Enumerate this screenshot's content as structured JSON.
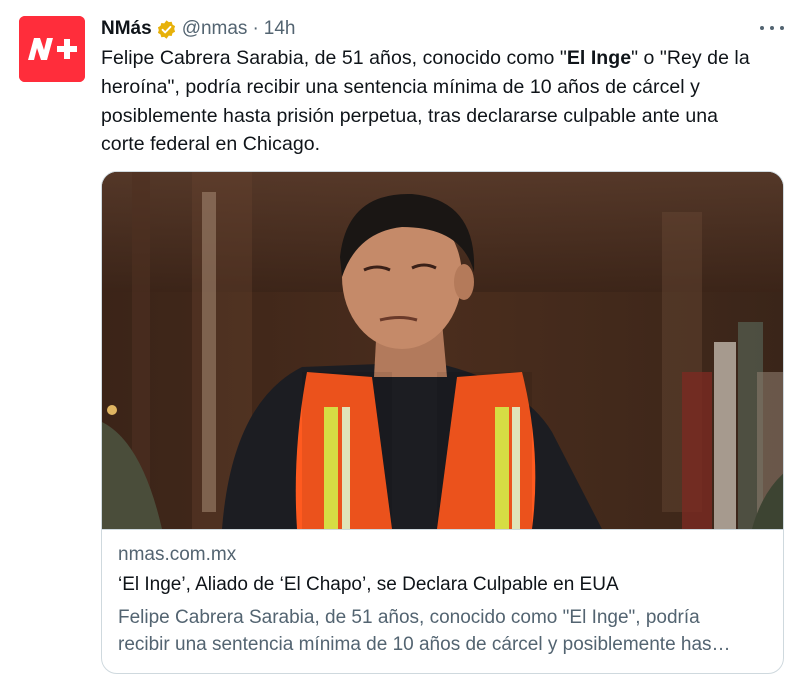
{
  "tweet": {
    "author": {
      "display_name": "NMás",
      "handle": "@nmas",
      "verified": true,
      "avatar_icon": "nmas-logo-icon"
    },
    "separator": "·",
    "timestamp": "14h",
    "text": {
      "line1_a": "Felipe Cabrera Sarabia, de 51 años, conocido como \"",
      "line1_bold": "El Inge",
      "line1_b": "\" o \"Rey de la",
      "line2": "heroína\", podría recibir una sentencia mínima de 10 años de cárcel y",
      "line3": "posiblemente hasta prisión perpetua, tras declararse culpable ante una",
      "line4": "corte federal en Chicago."
    },
    "card": {
      "domain": "nmas.com.mx",
      "title": "‘El Inge’, Aliado de ‘El Chapo’, se Declara Culpable en EUA",
      "description_line1": "Felipe Cabrera Sarabia, de 51 años, conocido como \"El Inge\", podría",
      "description_line2": "recibir una sentencia mínima de 10 años de cárcel y posiblemente has…"
    }
  },
  "colors": {
    "brand": "#ff2d3b",
    "verified": "#e7b10a",
    "text_primary": "#0f1419",
    "text_secondary": "#536471",
    "border": "#cfd9de",
    "vest_orange": "#ff5a1f",
    "vest_reflective": "#e9f04a"
  }
}
